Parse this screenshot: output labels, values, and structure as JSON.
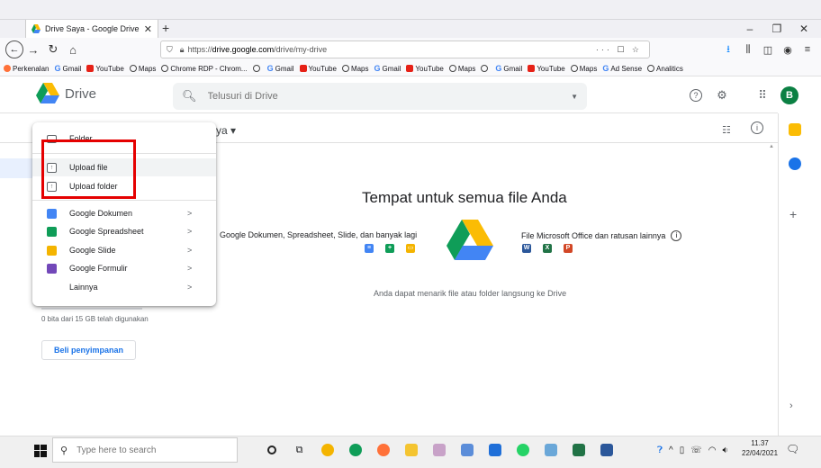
{
  "browser": {
    "tab_title": "Drive Saya - Google Drive",
    "tab_close": "✕",
    "new_tab": "+",
    "url_prefix": "https://",
    "url_host": "drive.google.com",
    "url_path": "/drive/my-drive",
    "url_actions": "··· ☐ ☆"
  },
  "bookmarks": [
    {
      "label": "Perkenalan",
      "icon": "firefox-icon"
    },
    {
      "label": "Gmail",
      "icon": "google-icon"
    },
    {
      "label": "YouTube",
      "icon": "youtube-icon"
    },
    {
      "label": "Maps",
      "icon": "globe-icon"
    },
    {
      "label": "Chrome RDP - Chrom...",
      "icon": "globe-icon"
    },
    {
      "label": "",
      "icon": "globe-icon"
    },
    {
      "label": "Gmail",
      "icon": "google-icon"
    },
    {
      "label": "YouTube",
      "icon": "youtube-icon"
    },
    {
      "label": "Maps",
      "icon": "globe-icon"
    },
    {
      "label": "Gmail",
      "icon": "google-icon"
    },
    {
      "label": "YouTube",
      "icon": "youtube-icon"
    },
    {
      "label": "Maps",
      "icon": "globe-icon"
    },
    {
      "label": "",
      "icon": "globe-icon"
    },
    {
      "label": "Gmail",
      "icon": "google-icon"
    },
    {
      "label": "YouTube",
      "icon": "youtube-icon"
    },
    {
      "label": "Maps",
      "icon": "globe-icon"
    },
    {
      "label": "Ad Sense",
      "icon": "google-icon"
    },
    {
      "label": "Analitics",
      "icon": "globe-icon"
    }
  ],
  "drive": {
    "title": "Drive",
    "search_placeholder": "Telusuri di Drive",
    "avatar_letter": "B",
    "mydrive_label": "ya ▾"
  },
  "menu": {
    "folder": "Folder",
    "upload_file": "Upload file",
    "upload_folder": "Upload folder",
    "google_dokumen": "Google Dokumen",
    "google_spreadsheet": "Google Spreadsheet",
    "google_slide": "Google Slide",
    "google_formulir": "Google Formulir",
    "lainnya": "Lainnya",
    "arrow": ">"
  },
  "empty_state": {
    "title": "Tempat untuk semua file Anda",
    "left_desc": "Google Dokumen, Spreadsheet, Slide, dan banyak lagi",
    "right_desc": "File Microsoft Office dan ratusan lainnya",
    "drop_hint": "Anda dapat menarik file atau folder langsung ke Drive"
  },
  "storage": {
    "text": "0 bita dari 15 GB telah digunakan",
    "buy_button": "Beli penyimpanan"
  },
  "taskbar": {
    "search_placeholder": "Type here to search",
    "time": "11.37",
    "date": "22/04/2021"
  },
  "colors": {
    "drive_blue": "#4285f4",
    "docs_blue": "#4285f4",
    "sheets_green": "#0f9d58",
    "slides_yellow": "#f4b400",
    "forms_purple": "#7248b9",
    "highlight_red": "#e50000",
    "avatar_green": "#0b8043"
  }
}
